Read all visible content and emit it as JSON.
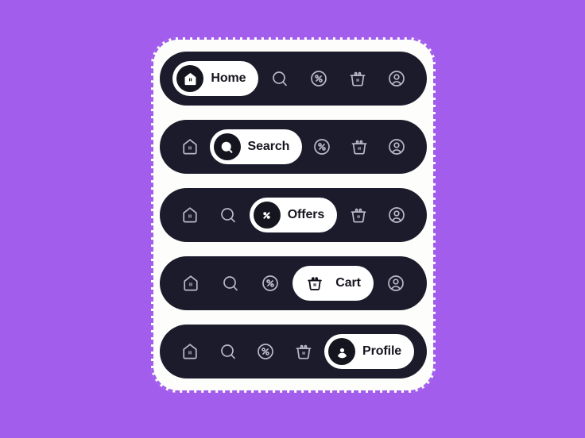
{
  "colors": {
    "background": "#a25dec",
    "card": "#fdfdfb",
    "bar": "#1b1b2c",
    "active_pill": "#ffffff",
    "active_text": "#15151f",
    "inactive_icon": "#b9b9c6"
  },
  "nav": {
    "items": [
      {
        "id": "home",
        "label": "Home",
        "icon": "home-icon"
      },
      {
        "id": "search",
        "label": "Search",
        "icon": "search-icon"
      },
      {
        "id": "offers",
        "label": "Offers",
        "icon": "percent-icon"
      },
      {
        "id": "cart",
        "label": "Cart",
        "icon": "basket-icon"
      },
      {
        "id": "profile",
        "label": "Profile",
        "icon": "person-icon"
      }
    ]
  },
  "bars": [
    {
      "active_index": 0,
      "active_label": "Home",
      "active_icon_style": "badge"
    },
    {
      "active_index": 1,
      "active_label": "Search",
      "active_icon_style": "badge"
    },
    {
      "active_index": 2,
      "active_label": "Offers",
      "active_icon_style": "badge"
    },
    {
      "active_index": 3,
      "active_label": "Cart",
      "active_icon_style": "plain"
    },
    {
      "active_index": 4,
      "active_label": "Profile",
      "active_icon_style": "badge"
    }
  ],
  "labels": {
    "home": "Home",
    "search": "Search",
    "offers": "Offers",
    "cart": "Cart",
    "profile": "Profile"
  }
}
